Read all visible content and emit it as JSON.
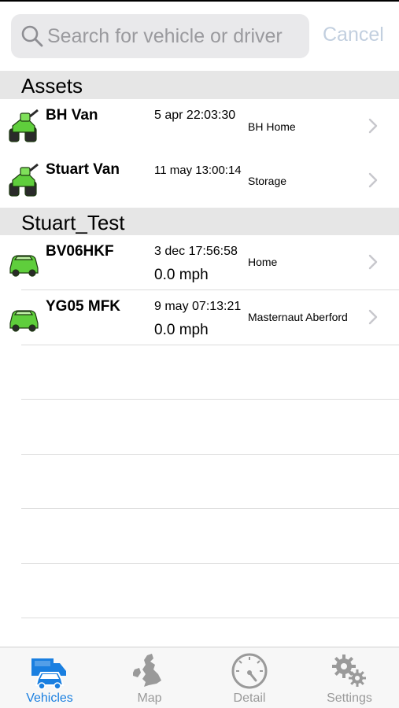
{
  "search": {
    "placeholder": "Search for vehicle or driver",
    "value": "",
    "cancel_label": "Cancel"
  },
  "sections": [
    {
      "title": "Assets",
      "rows": [
        {
          "name": "BH Van",
          "time": "5 apr 22:03:30",
          "location": "BH Home",
          "speed": "",
          "icon": "tractor-icon"
        },
        {
          "name": "Stuart Van",
          "time": "11 may 13:00:14",
          "location": "Storage",
          "speed": "",
          "icon": "tractor-icon"
        }
      ]
    },
    {
      "title": "Stuart_Test",
      "rows": [
        {
          "name": "BV06HKF",
          "time": "3 dec 17:56:58",
          "location": "Home",
          "speed": "0.0 mph",
          "icon": "car-icon"
        },
        {
          "name": "YG05 MFK",
          "time": "9 may 07:13:21",
          "location": "Masternaut Aberford",
          "speed": "0.0 mph",
          "icon": "car-icon"
        }
      ]
    }
  ],
  "tabbar": {
    "tabs": [
      {
        "label": "Vehicles",
        "icon": "vehicles-icon",
        "active": true
      },
      {
        "label": "Map",
        "icon": "uk-map-icon",
        "active": false
      },
      {
        "label": "Detail",
        "icon": "speedometer-icon",
        "active": false
      },
      {
        "label": "Settings",
        "icon": "gears-icon",
        "active": false
      }
    ]
  },
  "colors": {
    "accent": "#1a7fe0",
    "vehicle_green": "#5fce3c",
    "section_bg": "#e6e6e6",
    "inactive_tab": "#9a9a9a"
  }
}
